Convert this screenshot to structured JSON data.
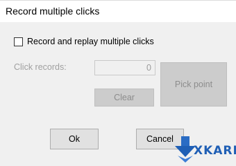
{
  "window": {
    "title": "Record multiple clicks"
  },
  "options": {
    "record_checkbox_label": "Record and replay multiple clicks",
    "record_checkbox_checked": false
  },
  "records": {
    "label": "Click records:",
    "value": "0"
  },
  "buttons": {
    "clear": "Clear",
    "pick_point": "Pick point",
    "ok": "Ok",
    "cancel": "Cancel"
  },
  "watermark": {
    "text": "XKARE",
    "color": "#1f5fb5",
    "icon": "download-arrow-icon"
  }
}
